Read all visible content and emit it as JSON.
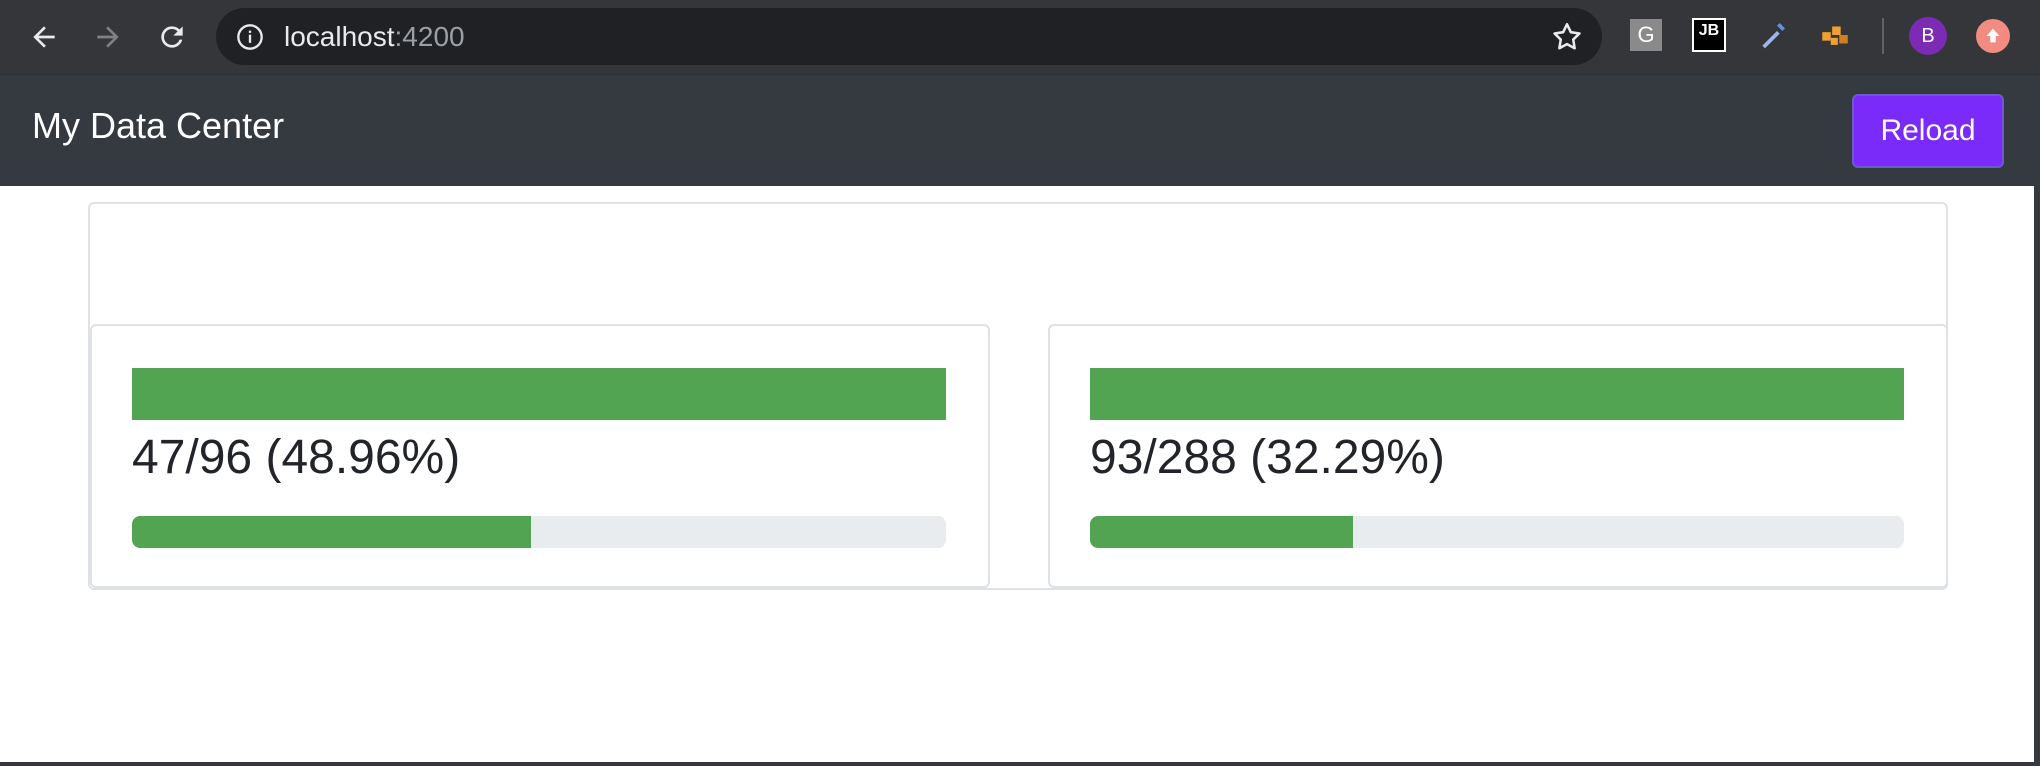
{
  "browser": {
    "url_host": "localhost",
    "url_port": ":4200",
    "extensions": [
      "G",
      "JB"
    ],
    "avatar_letter": "B"
  },
  "app": {
    "brand": "My Data Center",
    "reload_label": "Reload"
  },
  "stats": [
    {
      "label": "47/96 (48.96%)",
      "progress": 0.4896
    },
    {
      "label": "93/288 (32.29%)",
      "progress": 0.3229
    }
  ],
  "colors": {
    "accent": "#7b2bf9",
    "success": "#52a452",
    "navbar": "#343a40"
  }
}
